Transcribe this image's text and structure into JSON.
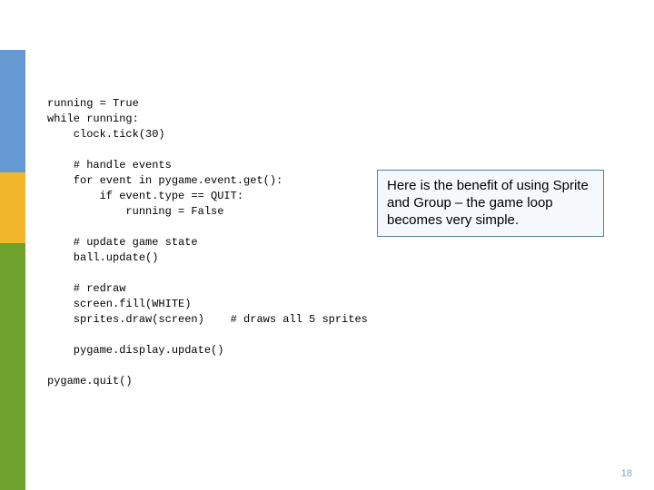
{
  "sidebar_colors": {
    "top": "#ffffff",
    "blue": "#6699d1",
    "yellow": "#f3b72b",
    "green": "#6ea22c"
  },
  "code": "running = True\nwhile running:\n    clock.tick(30)\n\n    # handle events\n    for event in pygame.event.get():\n        if event.type == QUIT:\n            running = False\n\n    # update game state\n    ball.update()\n\n    # redraw\n    screen.fill(WHITE)\n    sprites.draw(screen)    # draws all 5 sprites\n\n    pygame.display.update()\n\npygame.quit()",
  "callout_text": "Here is the benefit of using Sprite and Group – the game loop becomes very simple.",
  "page_number": "18"
}
